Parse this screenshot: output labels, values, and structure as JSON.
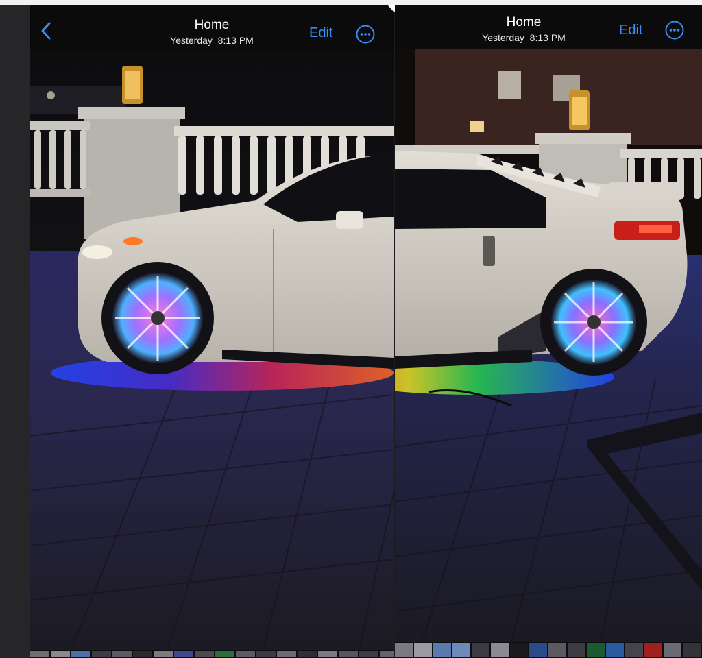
{
  "colors": {
    "accent": "#3b8cf5",
    "navbar": "#0b0b0c",
    "background": "#1c1c1e"
  },
  "left_screen": {
    "nav": {
      "back_icon": "chevron-left-icon",
      "title": "Home",
      "subtitle": "Yesterday  8:13 PM",
      "edit_label": "Edit",
      "more_icon": "ellipsis-circle-icon"
    },
    "photo": {
      "subject": "car with rainbow underglow and lit wheels"
    },
    "thumbnails": [
      {
        "color": "#6e6e72"
      },
      {
        "color": "#8a8a8e"
      },
      {
        "color": "#4b6fa8"
      },
      {
        "color": "#3c3c42"
      },
      {
        "color": "#5a5a60"
      },
      {
        "color": "#2a2a30"
      },
      {
        "color": "#7a7a80"
      },
      {
        "color": "#3b4a90"
      },
      {
        "color": "#4a4a50"
      },
      {
        "color": "#2c6c3a"
      },
      {
        "color": "#5b5b66"
      },
      {
        "color": "#3a3a44"
      },
      {
        "color": "#6a6a70"
      },
      {
        "color": "#2e2e36"
      },
      {
        "color": "#7a7a82"
      },
      {
        "color": "#55555c"
      },
      {
        "color": "#3d3d45"
      },
      {
        "color": "#64646c"
      }
    ]
  },
  "right_screen": {
    "nav": {
      "back_icon": "chevron-left-icon",
      "title": "Home",
      "subtitle": "Yesterday  8:13 PM",
      "edit_label": "Edit",
      "more_icon": "ellipsis-circle-icon"
    },
    "photo": {
      "subject": "car with rainbow underglow and lit wheels, rear view"
    },
    "thumbnails": [
      {
        "color": "#7a7a80"
      },
      {
        "color": "#9a9aa0"
      },
      {
        "color": "#5a7ab0"
      },
      {
        "color": "#6d8ab8"
      },
      {
        "color": "#3a3a40"
      },
      {
        "color": "#8a8a90"
      },
      {
        "color": "#1a1a1e"
      },
      {
        "color": "#2a4a8a"
      },
      {
        "color": "#5a5a60"
      },
      {
        "color": "#3c3c44"
      },
      {
        "color": "#1c5a30"
      },
      {
        "color": "#2a5aa0"
      },
      {
        "color": "#44444c"
      },
      {
        "color": "#a02020"
      },
      {
        "color": "#6a6a72"
      },
      {
        "color": "#333338"
      }
    ]
  }
}
